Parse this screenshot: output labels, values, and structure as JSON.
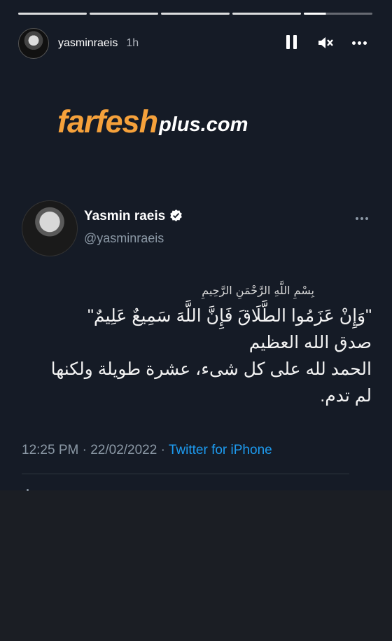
{
  "story": {
    "username": "yasminraeis",
    "time": "1h",
    "progress_segments": 5
  },
  "watermark": {
    "main": "farfesh",
    "sub": "plus.com"
  },
  "tweet": {
    "name": "Yasmin raeis",
    "handle": "@yasminraeis",
    "basmala": "بِسْمِ اللَّهِ الرَّحْمَنِ الرَّحِيمِ",
    "lines": [
      "\"وَإِنْ عَزَمُوا الطَّلَاقَ فَإِنَّ اللَّهَ سَمِيعٌ عَلِيمٌ\"",
      "صدق الله العظيم",
      "الحمد لله على كل شىء، عشرة طويلة ولكنها",
      "لم تدم."
    ],
    "timestamp": "12:25 PM · 22/02/2022 · ",
    "source": "Twitter for iPhone"
  },
  "colors": {
    "accent": "#1d9bf0",
    "logo_orange": "#f5a13b"
  }
}
